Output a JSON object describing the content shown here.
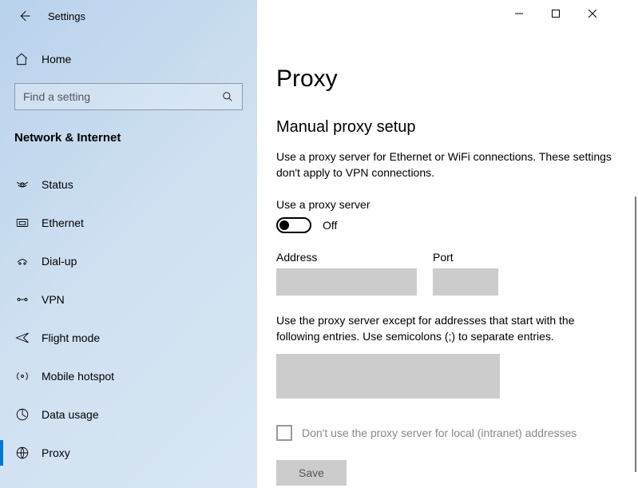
{
  "window": {
    "app_title": "Settings"
  },
  "sidebar": {
    "home_label": "Home",
    "search_placeholder": "Find a setting",
    "section_label": "Network & Internet",
    "items": [
      {
        "label": "Status",
        "icon": "status-icon"
      },
      {
        "label": "Ethernet",
        "icon": "ethernet-icon"
      },
      {
        "label": "Dial-up",
        "icon": "dialup-icon"
      },
      {
        "label": "VPN",
        "icon": "vpn-icon"
      },
      {
        "label": "Flight mode",
        "icon": "airplane-icon"
      },
      {
        "label": "Mobile hotspot",
        "icon": "hotspot-icon"
      },
      {
        "label": "Data usage",
        "icon": "datausage-icon"
      },
      {
        "label": "Proxy",
        "icon": "globe-icon"
      }
    ],
    "selected_index": 7
  },
  "main": {
    "page_title": "Proxy",
    "section_title": "Manual proxy setup",
    "description": "Use a proxy server for Ethernet or WiFi connections. These settings don't apply to VPN connections.",
    "use_proxy_label": "Use a proxy server",
    "toggle_state_label": "Off",
    "toggle_on": false,
    "address_label": "Address",
    "address_value": "",
    "port_label": "Port",
    "port_value": "",
    "exclusion_desc": "Use the proxy server except for addresses that start with the following entries. Use semicolons (;) to separate entries.",
    "exclusion_value": "",
    "local_checkbox_label": "Don't use the proxy server for local (intranet) addresses",
    "local_checked": false,
    "save_label": "Save"
  }
}
